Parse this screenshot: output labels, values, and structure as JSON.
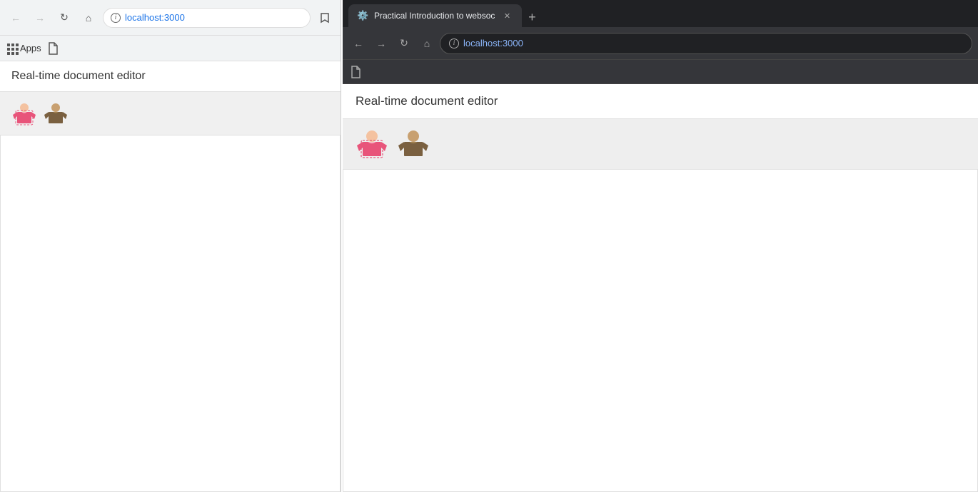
{
  "left_browser": {
    "url": "localhost:3000",
    "bookmarks": {
      "apps_label": "Apps"
    },
    "page_title": "Real-time document editor",
    "tab_icon": "📄"
  },
  "right_browser": {
    "url": "localhost:3000",
    "tab_title": "Practical Introduction to websoc",
    "page_title": "Real-time document editor"
  },
  "icons": {
    "back": "←",
    "forward": "→",
    "reload": "↻",
    "home": "⌂",
    "close": "✕",
    "new_tab": "+",
    "grid": "⊞",
    "bookmark": "📄",
    "info": "i"
  }
}
